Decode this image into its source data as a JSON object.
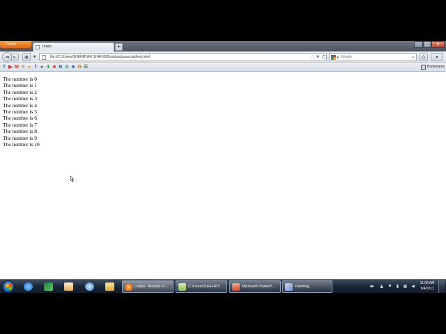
{
  "browser": {
    "app_button_label": "Firefox",
    "tab_title": "Loops",
    "new_tab_symbol": "+",
    "back_symbol": "◄",
    "forward_symbol": "►",
    "reload_symbol": "C",
    "url": "file:///C:/Users/SHEHRYAR SHAHID/Desktop/javascript/test.html",
    "search_placeholder": "Google",
    "bookmarks_label": "Bookmarks"
  },
  "page": {
    "lines": [
      "The number is 0",
      "The number is 1",
      "The number is 2",
      "The number is 3",
      "The number is 4",
      "The number is 5",
      "The number is 6",
      "The number is 7",
      "The number is 8",
      "The number is 9",
      "The number is 10"
    ]
  },
  "taskbar": {
    "tasks": [
      {
        "label": "Loops - Mozilla Fi...",
        "icon": "firefox-icon",
        "color": "#e8752a"
      },
      {
        "label": "C:\\Users\\SHEHRY...",
        "icon": "notepad-icon",
        "color": "#8bbf5a"
      },
      {
        "label": "Microsoft PowerP...",
        "icon": "powerpoint-icon",
        "color": "#d24726"
      },
      {
        "label": "Flashing",
        "icon": "flash-icon",
        "color": "#6c8fd0"
      }
    ],
    "clock_time": "11:06 AM",
    "clock_date": "9/4/2011"
  },
  "colors": {
    "firefox_orange": "#e0671a",
    "taskbar": "#1b2738",
    "content_bg": "#ffffff"
  }
}
